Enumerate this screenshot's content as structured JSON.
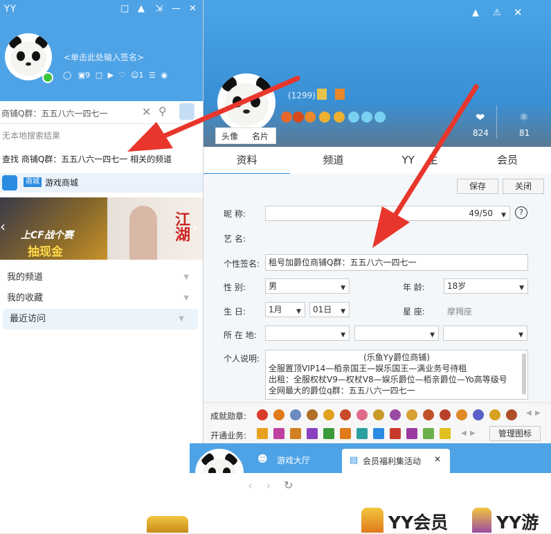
{
  "left_panel": {
    "app_title": "YY",
    "signature_prompt": "<单击此处输入签名>",
    "badges": {
      "one": "9",
      "two": "1"
    },
    "search": {
      "value": "商铺Q群：五五八六一四七一"
    },
    "no_local_result": "无本地搜索结果",
    "find_channel_text": "查找 商铺Q群：五五八六一四七一 相关的频道",
    "store": {
      "tag": "商城",
      "name": "游戏商城"
    },
    "banner_1": {
      "line1": "上CF战个赛",
      "line2": "抽现金"
    },
    "banner_2": {
      "text": "江湖"
    },
    "menu": [
      {
        "label": "我的频道"
      },
      {
        "label": "我的收藏"
      },
      {
        "label": "最近访问"
      }
    ]
  },
  "profile": {
    "yy_number": "(1299)",
    "photo_tabs": [
      "头像",
      "名片"
    ],
    "likes": "824",
    "fans": "81",
    "tabs": [
      "资料",
      "频道",
      "YY",
      "生",
      "会员"
    ],
    "buttons": {
      "save": "保存",
      "close": "关闭"
    },
    "nickname_label": "昵    称:",
    "nickname_count": "49/50",
    "stage_name_label": "艺    名:",
    "signature_label": "个性签名:",
    "signature_value": "租号加爵位商铺Q群：五五八六一四七一",
    "gender_label": "性    别:",
    "gender_value": "男",
    "age_label": "年    龄:",
    "age_value": "18岁",
    "birthday_label": "生    日:",
    "birth_month": "1月",
    "birth_day": "01日",
    "zodiac_label": "星    座:",
    "zodiac_value": "摩羯座",
    "location_label": "所 在 地:",
    "bio_label": "个人说明:",
    "bio_lines": [
      "(乐鱼Yy爵位商铺)",
      "全服置顶VIP14—栢亲国王—娱乐国王—满业务号待租",
      "出租：全服权杖V9—权杖V8—娱乐爵位—栢亲爵位—Yo高等级号",
      "全网最大的爵位q群：五五八六一四七一"
    ],
    "medals_label": "成就勋章:",
    "services_label": "开通业务:",
    "manage_icons": "管理图标"
  },
  "bottom_window": {
    "tab_game_hall": "游戏大厅",
    "tab_member": "会员福利集活动",
    "banner_text_1": "YY会员",
    "banner_text_2": "YY游"
  },
  "colors": {
    "header_blue": "#4ea3e6",
    "arrow_red": "#e8362c",
    "accent": "#2a8ce0"
  }
}
